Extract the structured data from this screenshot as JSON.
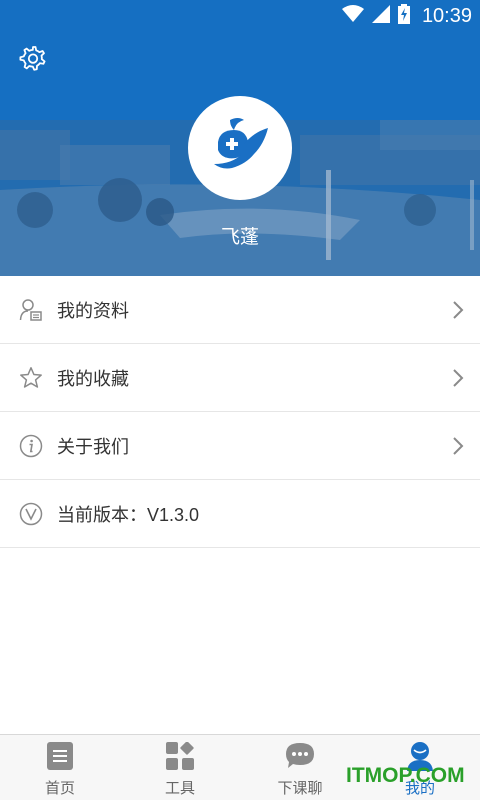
{
  "status_bar": {
    "time": "10:39"
  },
  "header": {
    "username": "飞蓬"
  },
  "menu": {
    "items": [
      {
        "label": "我的资料",
        "icon": "profile-card-icon"
      },
      {
        "label": "我的收藏",
        "icon": "star-icon"
      },
      {
        "label": "关于我们",
        "icon": "info-icon"
      }
    ],
    "version": {
      "label": "当前版本：",
      "value": "V1.3.0",
      "icon": "version-icon"
    }
  },
  "bottom_nav": {
    "items": [
      {
        "label": "首页",
        "icon": "document-icon",
        "active": false
      },
      {
        "label": "工具",
        "icon": "tools-grid-icon",
        "active": false
      },
      {
        "label": "下课聊",
        "icon": "chat-bubble-icon",
        "active": false
      },
      {
        "label": "我的",
        "icon": "user-icon",
        "active": true
      }
    ]
  },
  "watermark": "ITMOP.COM",
  "colors": {
    "accent": "#1a6fc4",
    "header_blue": "#1570c2",
    "watermark_green": "#2aa02a"
  }
}
